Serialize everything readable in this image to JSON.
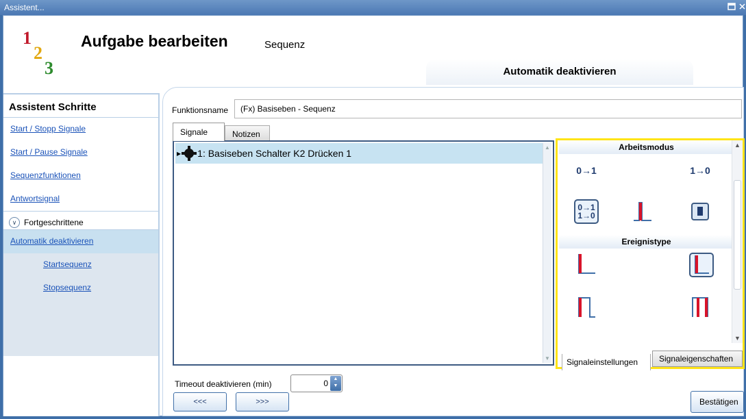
{
  "window": {
    "title": "Assistent..."
  },
  "logo": {
    "digits": [
      "1",
      "2",
      "3"
    ]
  },
  "header": {
    "title": "Aufgabe bearbeiten",
    "subtitle": "Sequenz",
    "section_tab": "Automatik deaktivieren"
  },
  "sidebar": {
    "title": "Assistent Schritte",
    "items": [
      {
        "label": "Start / Stopp Signale"
      },
      {
        "label": "Start / Pause Signale"
      },
      {
        "label": "Sequenzfunktionen"
      },
      {
        "label": "Antwortsignal"
      }
    ],
    "advanced_label": "Fortgeschrittene",
    "sub_items": [
      {
        "label": "Automatik deaktivieren",
        "active": true
      },
      {
        "label": "Startsequenz"
      },
      {
        "label": "Stopsequenz"
      }
    ]
  },
  "form": {
    "function_name_label": "Funktionsname",
    "function_name_value": "(Fx) Basiseben - Sequenz"
  },
  "tabs": [
    {
      "label": "Signale",
      "selected": true
    },
    {
      "label": "Notizen"
    }
  ],
  "signals": [
    {
      "label": "1: Basiseben Schalter K2 Drücken 1"
    }
  ],
  "properties": {
    "work_mode_heading": "Arbeitsmodus",
    "work_modes": [
      {
        "icon": "rising-edge-0-1-icon",
        "text": "0→1"
      },
      {
        "icon": "falling-edge-1-0-icon",
        "text": "1→0"
      },
      {
        "icon": "both-edges-icon",
        "text": [
          "0→1",
          "1→0"
        ],
        "selected": true
      },
      {
        "icon": "pulse-red-icon"
      },
      {
        "icon": "box-pulse-icon"
      }
    ],
    "event_type_heading": "Ereignistype",
    "event_types": [
      {
        "icon": "event-step-icon"
      },
      {
        "icon": "event-step-selected-icon",
        "selected": true
      },
      {
        "icon": "event-pulse-icon"
      },
      {
        "icon": "event-pulse-double-icon"
      }
    ],
    "tabs": [
      {
        "label": "Signaleinstellungen",
        "selected": true
      },
      {
        "label": "Signaleigenschaften"
      }
    ]
  },
  "timeout": {
    "label": "Timeout deaktivieren (min)",
    "value": "0"
  },
  "buttons": {
    "back": "<<<",
    "next": ">>>",
    "confirm": "Bestätigen"
  },
  "colors": {
    "accent": "#3f6fa8",
    "highlight": "#ffe417",
    "selection": "#c7e3f2",
    "pulse_red": "#d9142a"
  }
}
